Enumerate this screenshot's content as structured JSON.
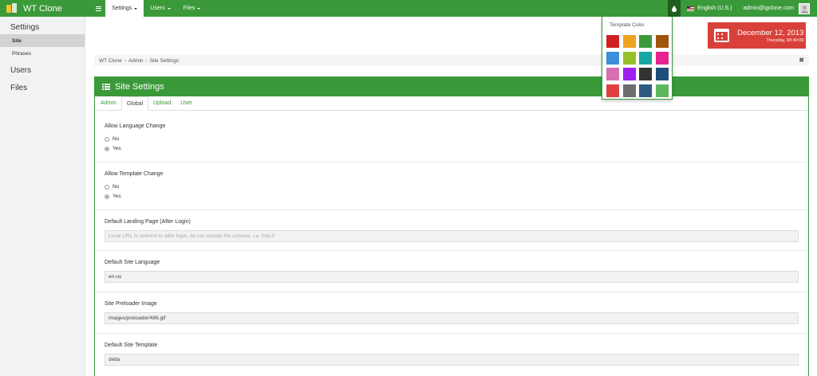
{
  "app": {
    "name": "WT Clone"
  },
  "navbar": {
    "menu": [
      {
        "label": "Settings",
        "active": true
      },
      {
        "label": "Users",
        "active": false
      },
      {
        "label": "Files",
        "active": false
      }
    ],
    "language": "English (U.S.)",
    "user_email": "admin@igclone.com"
  },
  "sidebar": {
    "sections": [
      {
        "label": "Settings",
        "items": [
          {
            "label": "Site",
            "active": true
          },
          {
            "label": "Phrases",
            "active": false
          }
        ]
      },
      {
        "label": "Users",
        "items": []
      },
      {
        "label": "Files",
        "items": []
      }
    ]
  },
  "date_widget": {
    "date": "December 12, 2013",
    "detail": "Thursday, 00:40:09"
  },
  "breadcrumb": {
    "items": [
      "WT Clone",
      "Admin",
      "Site Settings"
    ],
    "separator": "›",
    "close": "✖"
  },
  "template_color": {
    "title": "Template Color",
    "swatches": [
      "#d21f1f",
      "#f0a21e",
      "#3a9a3a",
      "#a0540c",
      "#3c8fd9",
      "#96c02a",
      "#17a6a2",
      "#e8228e",
      "#d670b0",
      "#a020f0",
      "#333333",
      "#1f4e79",
      "#e04040",
      "#6d6d6d",
      "#2f5a84",
      "#5cb85c"
    ]
  },
  "panel": {
    "title": "Site Settings",
    "tabs": [
      {
        "label": "Admin",
        "active": false
      },
      {
        "label": "Global",
        "active": true
      },
      {
        "label": "Upload",
        "active": false
      },
      {
        "label": "User",
        "active": false
      }
    ],
    "fields": {
      "allow_language": {
        "label": "Allow Language Change",
        "options": [
          "No",
          "Yes"
        ],
        "selected": "Yes"
      },
      "allow_template": {
        "label": "Allow Template Change",
        "options": [
          "No",
          "Yes"
        ],
        "selected": "Yes"
      },
      "landing_page": {
        "label": "Default Landing Page (After Login)",
        "value": "",
        "placeholder": "Local URL to redirect to after login, do not include the scheme, i.e. http://"
      },
      "site_language": {
        "label": "Default Site Language",
        "value": "en-us"
      },
      "preloader": {
        "label": "Site Preloader Image",
        "value": "images/preloader/486.gif"
      },
      "site_template": {
        "label": "Default Site Template",
        "value": "delta"
      }
    }
  },
  "colors": {
    "brand_green": "#3a9a3a",
    "date_red": "#d9403a"
  }
}
